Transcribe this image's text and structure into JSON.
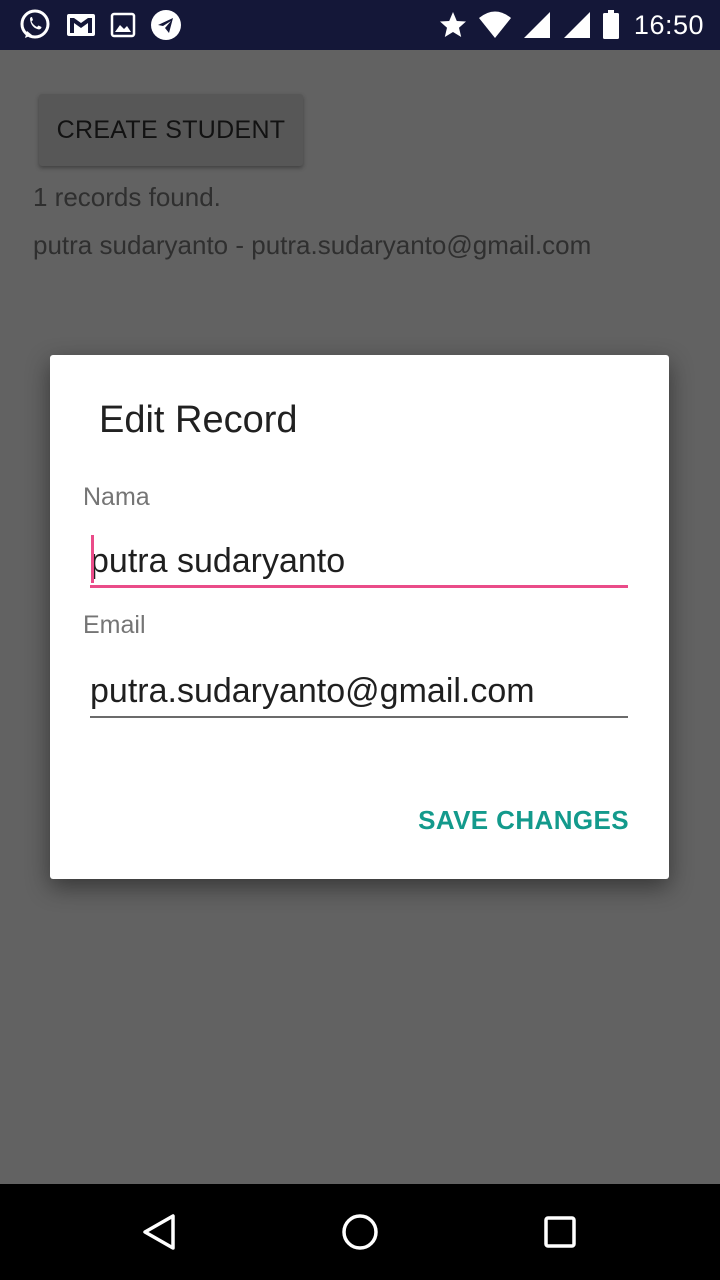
{
  "status_bar": {
    "time": "16:50",
    "left_icons": [
      "whatsapp-icon",
      "gmail-icon",
      "image-icon",
      "telegram-icon"
    ],
    "right_icons": [
      "star-icon",
      "wifi-icon",
      "signal-icon",
      "signal-icon",
      "battery-icon"
    ]
  },
  "main": {
    "create_button_label": "CREATE STUDENT",
    "records_count": "1 records found.",
    "records": [
      {
        "text": "putra sudaryanto - putra.sudaryanto@gmail.com"
      }
    ]
  },
  "dialog": {
    "title": "Edit Record",
    "fields": [
      {
        "label": "Nama",
        "value": "putra sudaryanto"
      },
      {
        "label": "Email",
        "value": "putra.sudaryanto@gmail.com"
      }
    ],
    "save_label": "SAVE CHANGES"
  },
  "colors": {
    "status_bar": "#141738",
    "scrim_background": "#626262",
    "accent": "#ea4c89",
    "button_text": "#139a8c"
  }
}
